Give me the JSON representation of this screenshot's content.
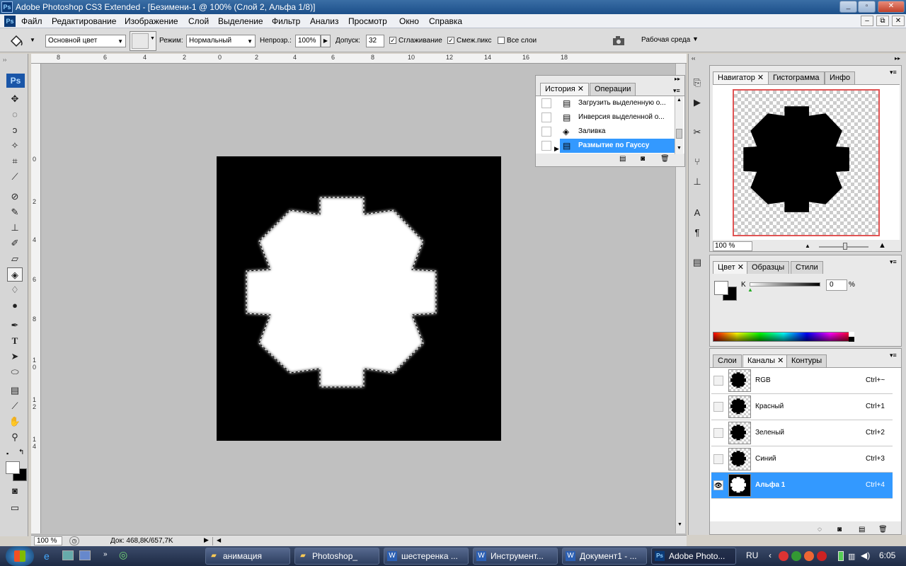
{
  "window": {
    "title": "Adobe Photoshop CS3 Extended - [Безимени-1 @ 100% (Слой 2, Альфа 1/8)]",
    "app_icon": "Ps",
    "minimize": "_",
    "restore": "▫",
    "close": "✕"
  },
  "doc_controls": {
    "minimize": "–",
    "restore": "⧉",
    "close": "✕"
  },
  "menu": [
    "Файл",
    "Редактирование",
    "Изображение",
    "Слой",
    "Выделение",
    "Фильтр",
    "Анализ",
    "Просмотр",
    "Окно",
    "Справка"
  ],
  "options": {
    "fill_source": "Основной цвет",
    "mode_label": "Режим:",
    "mode_value": "Нормальный",
    "opacity_label": "Непрозр.:",
    "opacity_value": "100%",
    "tolerance_label": "Допуск:",
    "tolerance_value": "32",
    "antialias_label": "Сглаживание",
    "contiguous_label": "Смеж.пикс",
    "all_layers_label": "Все слои",
    "workspace_label": "Рабочая среда"
  },
  "rulers": {
    "top": [
      "8",
      "6",
      "4",
      "2",
      "0",
      "2",
      "4",
      "6",
      "8",
      "10",
      "12",
      "14",
      "16",
      "18"
    ],
    "left": [
      "0",
      "2",
      "4",
      "6",
      "8",
      "1 0",
      "1 2",
      "1 4"
    ]
  },
  "status": {
    "zoom": "100 %",
    "doc_size": "Док: 468,8K/657,7K"
  },
  "history": {
    "tabs": [
      "История",
      "Операции"
    ],
    "items": [
      {
        "label": "Загрузить выделенную о...",
        "icon": "document-icon"
      },
      {
        "label": "Инверсия выделенной о...",
        "icon": "document-icon"
      },
      {
        "label": "Заливка",
        "icon": "paint-bucket-icon"
      },
      {
        "label": "Размытие по Гауссу",
        "icon": "document-icon",
        "selected": true
      }
    ]
  },
  "navigator": {
    "tabs": [
      "Навигатор",
      "Гистограмма",
      "Инфо"
    ],
    "zoom": "100 %"
  },
  "color": {
    "tabs": [
      "Цвет",
      "Образцы",
      "Стили"
    ],
    "channel": "K",
    "value": "0",
    "unit": "%"
  },
  "channels": {
    "tabs": [
      "Слои",
      "Каналы",
      "Контуры"
    ],
    "rows": [
      {
        "name": "RGB",
        "shortcut": "Ctrl+~",
        "visible": false,
        "selected": false
      },
      {
        "name": "Красный",
        "shortcut": "Ctrl+1",
        "visible": false,
        "selected": false
      },
      {
        "name": "Зеленый",
        "shortcut": "Ctrl+2",
        "visible": false,
        "selected": false
      },
      {
        "name": "Синий",
        "shortcut": "Ctrl+3",
        "visible": false,
        "selected": false
      },
      {
        "name": "Альфа 1",
        "shortcut": "Ctrl+4",
        "visible": true,
        "selected": true
      }
    ]
  },
  "taskbar": {
    "items": [
      {
        "label": "анимация",
        "icon": "folder-icon"
      },
      {
        "label": "Photoshop_",
        "icon": "folder-icon"
      },
      {
        "label": "шестеренка ...",
        "icon": "word-icon"
      },
      {
        "label": "Инструмент...",
        "icon": "word-icon"
      },
      {
        "label": "Документ1 - ...",
        "icon": "word-icon"
      },
      {
        "label": "Adobe Photo...",
        "icon": "photoshop-icon",
        "active": true
      }
    ],
    "lang": "RU",
    "time": "6:05"
  },
  "colors": {
    "selection": "#3399ff",
    "titlebar": "#1c4f8a"
  }
}
